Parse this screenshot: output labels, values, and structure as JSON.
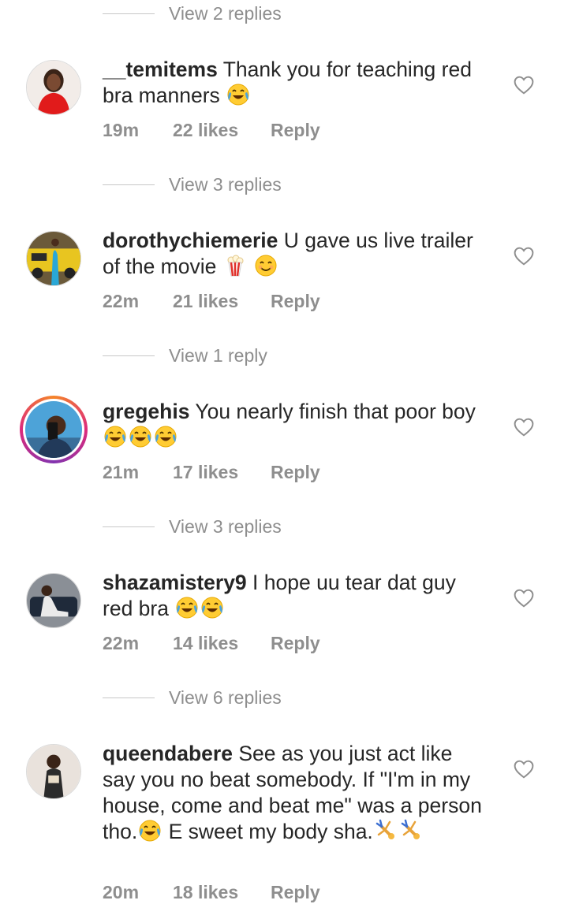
{
  "comments": [
    {
      "username": "__temitems",
      "text": "Thank you for teaching red bra manners",
      "time": "19m",
      "likes": "22 likes",
      "reply_label": "Reply",
      "view_replies": "View 3 replies"
    },
    {
      "username": "dorothychiemerie",
      "text": "U gave us live trailer of the movie",
      "time": "22m",
      "likes": "21 likes",
      "reply_label": "Reply",
      "view_replies": "View 1 reply"
    },
    {
      "username": "gregehis",
      "text": "You nearly finish that poor boy",
      "time": "21m",
      "likes": "17 likes",
      "reply_label": "Reply",
      "view_replies": "View 3 replies"
    },
    {
      "username": "shazamistery9",
      "text": "I hope uu tear dat guy red bra",
      "time": "22m",
      "likes": "14 likes",
      "reply_label": "Reply",
      "view_replies": "View 6 replies"
    },
    {
      "username": "queendabere",
      "text_part1": "See as you just act like say you no beat somebody. If \"I'm in my house, come and beat me\" was a person tho.",
      "text_part2": " E sweet my  body sha.",
      "time": "20m",
      "likes": "18 likes",
      "reply_label": "Reply"
    }
  ],
  "top_view_replies": "View 2 replies",
  "icons": {
    "like": "heart-outline-icon",
    "laugh": "tears-of-joy-emoji",
    "popcorn": "popcorn-emoji",
    "smile": "smiling-emoji",
    "cartwheel": "cartwheel-emoji"
  },
  "colors": {
    "text": "#262626",
    "muted": "#8e8e8e",
    "divider": "#c7c7c7",
    "story_ring": "#dd2a7b"
  }
}
